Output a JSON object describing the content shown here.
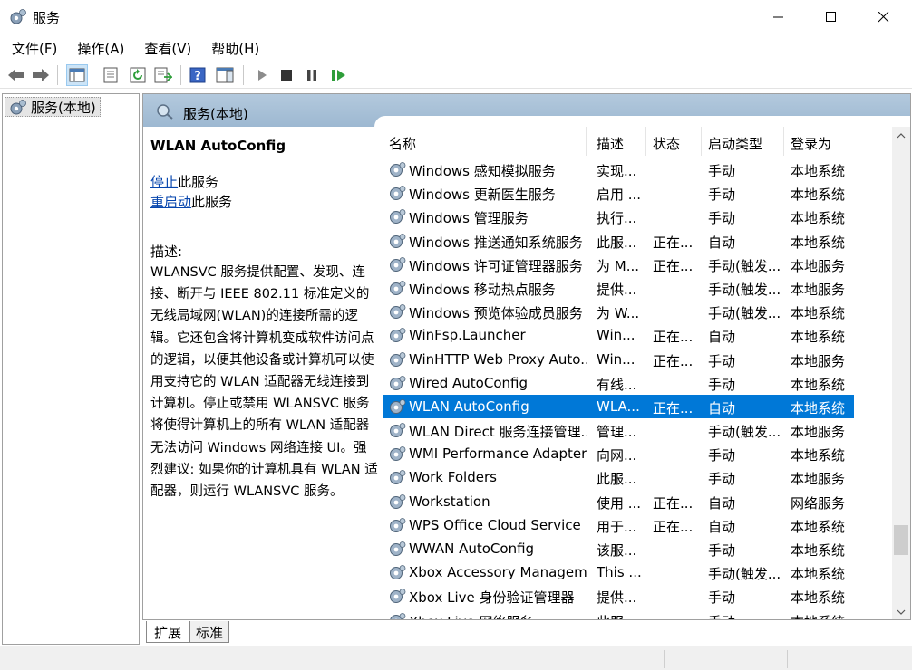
{
  "window": {
    "title": "服务"
  },
  "menu": [
    "文件(F)",
    "操作(A)",
    "查看(V)",
    "帮助(H)"
  ],
  "tree": {
    "root_label": "服务(本地)"
  },
  "main": {
    "header": "服务(本地)",
    "selected_service": "WLAN AutoConfig",
    "stop_link": "停止",
    "stop_suffix": "此服务",
    "restart_link": "重启动",
    "restart_suffix": "此服务",
    "desc_label": "描述:",
    "description": "WLANSVC 服务提供配置、发现、连接、断开与 IEEE 802.11 标准定义的无线局域网(WLAN)的连接所需的逻辑。它还包含将计算机变成软件访问点的逻辑，以便其他设备或计算机可以使用支持它的 WLAN 适配器无线连接到计算机。停止或禁用 WLANSVC 服务将使得计算机上的所有 WLAN 适配器无法访问 Windows 网络连接 UI。强烈建议: 如果你的计算机具有 WLAN 适配器，则运行 WLANSVC 服务。"
  },
  "columns": {
    "name": "名称",
    "desc": "描述",
    "status": "状态",
    "startup": "启动类型",
    "logon": "登录为"
  },
  "rows": [
    {
      "name": "Windows 感知模拟服务",
      "desc": "实现...",
      "status": "",
      "startup": "手动",
      "logon": "本地系统"
    },
    {
      "name": "Windows 更新医生服务",
      "desc": "启用 ...",
      "status": "",
      "startup": "手动",
      "logon": "本地系统"
    },
    {
      "name": "Windows 管理服务",
      "desc": "执行...",
      "status": "",
      "startup": "手动",
      "logon": "本地系统"
    },
    {
      "name": "Windows 推送通知系统服务",
      "desc": "此服...",
      "status": "正在...",
      "startup": "自动",
      "logon": "本地系统"
    },
    {
      "name": "Windows 许可证管理器服务",
      "desc": "为 M...",
      "status": "正在...",
      "startup": "手动(触发...",
      "logon": "本地服务"
    },
    {
      "name": "Windows 移动热点服务",
      "desc": "提供...",
      "status": "",
      "startup": "手动(触发...",
      "logon": "本地服务"
    },
    {
      "name": "Windows 预览体验成员服务",
      "desc": "为 W...",
      "status": "",
      "startup": "手动(触发...",
      "logon": "本地系统"
    },
    {
      "name": "WinFsp.Launcher",
      "desc": "Win...",
      "status": "正在...",
      "startup": "自动",
      "logon": "本地系统"
    },
    {
      "name": "WinHTTP Web Proxy Auto...",
      "desc": "Win...",
      "status": "正在...",
      "startup": "手动",
      "logon": "本地服务"
    },
    {
      "name": "Wired AutoConfig",
      "desc": "有线...",
      "status": "",
      "startup": "手动",
      "logon": "本地系统"
    },
    {
      "name": "WLAN AutoConfig",
      "desc": "WLA...",
      "status": "正在...",
      "startup": "自动",
      "logon": "本地系统"
    },
    {
      "name": "WLAN Direct 服务连接管理...",
      "desc": "管理...",
      "status": "",
      "startup": "手动(触发...",
      "logon": "本地服务"
    },
    {
      "name": "WMI Performance Adapter",
      "desc": "向网...",
      "status": "",
      "startup": "手动",
      "logon": "本地系统"
    },
    {
      "name": "Work Folders",
      "desc": "此服...",
      "status": "",
      "startup": "手动",
      "logon": "本地服务"
    },
    {
      "name": "Workstation",
      "desc": "使用 ...",
      "status": "正在...",
      "startup": "自动",
      "logon": "网络服务"
    },
    {
      "name": "WPS Office Cloud Service",
      "desc": "用于...",
      "status": "正在...",
      "startup": "自动",
      "logon": "本地系统"
    },
    {
      "name": "WWAN AutoConfig",
      "desc": "该服...",
      "status": "",
      "startup": "手动",
      "logon": "本地系统"
    },
    {
      "name": "Xbox Accessory Managem...",
      "desc": "This ...",
      "status": "",
      "startup": "手动(触发...",
      "logon": "本地系统"
    },
    {
      "name": "Xbox Live 身份验证管理器",
      "desc": "提供...",
      "status": "",
      "startup": "手动",
      "logon": "本地系统"
    },
    {
      "name": "Xbox Live 网络服务",
      "desc": "此服...",
      "status": "",
      "startup": "手动",
      "logon": "本地系统"
    }
  ],
  "selected_index": 10,
  "tabs": {
    "extended": "扩展",
    "standard": "标准"
  }
}
